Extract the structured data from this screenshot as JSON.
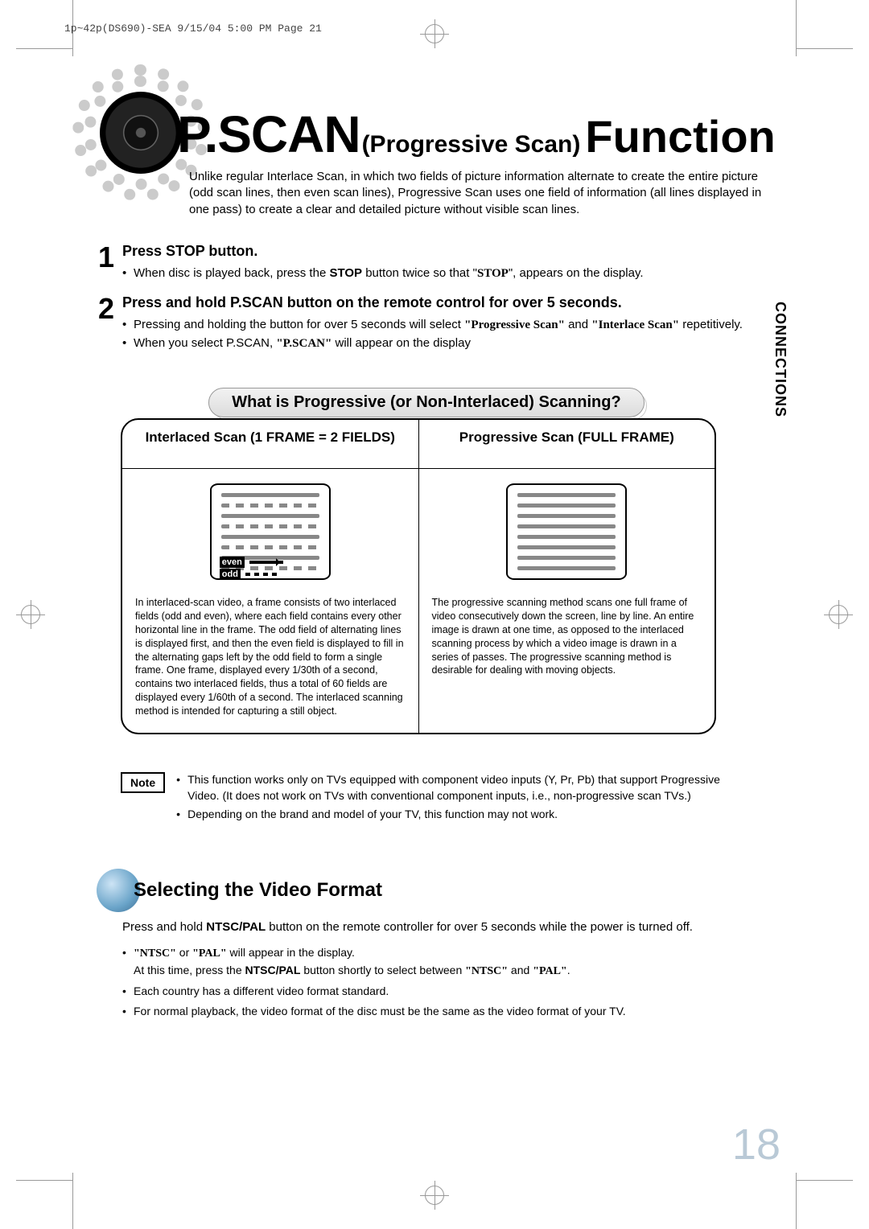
{
  "header_strip": "1p~42p(DS690)-SEA  9/15/04 5:00 PM  Page 21",
  "title": {
    "pscan": "P.SCAN",
    "sub": "(Progressive Scan)",
    "func": "Function"
  },
  "intro": "Unlike regular Interlace Scan, in which two fields of picture information alternate to create the entire picture (odd scan lines, then even scan lines), Progressive Scan uses one field of information (all lines displayed in one pass) to create a clear and detailed picture without visible scan lines.",
  "steps": [
    {
      "num": "1",
      "heading": "Press STOP button.",
      "bullets": [
        {
          "pre": "When disc is played back, press the ",
          "b1": "STOP",
          "mid": " button twice so that \"",
          "q": "STOP",
          "post": "\", appears on the display."
        }
      ]
    },
    {
      "num": "2",
      "heading": "Press and hold P.SCAN button on the remote control for over 5 seconds.",
      "bullets": [
        {
          "pre": "Pressing and holding the button for over 5 seconds will select ",
          "q": "\"Progressive Scan\"",
          "mid": " and ",
          "q2": "\"Interlace Scan\"",
          "post": " repetitively."
        },
        {
          "pre": "When you select P.SCAN, ",
          "q": "\"P.SCAN\"",
          "post": " will appear on the display"
        }
      ]
    }
  ],
  "side_tab": "CONNECTIONS",
  "info_heading": "What is Progressive (or Non-Interlaced) Scanning?",
  "compare": {
    "left": {
      "head": "Interlaced Scan (1 FRAME = 2 FIELDS)",
      "legend_even": "even",
      "legend_odd": "odd",
      "text": "In interlaced-scan video, a frame consists of two interlaced fields (odd and even), where each field contains every other horizontal line in the frame. The odd field of alternating lines is displayed first, and then the even field is displayed to fill in the alternating gaps left by the odd field to form a single frame. One frame, displayed every 1/30th of a second, contains two interlaced fields, thus a total of 60 fields are displayed every 1/60th of a second. The interlaced scanning method is intended for capturing a still object."
    },
    "right": {
      "head": "Progressive Scan (FULL FRAME)",
      "text": "The progressive scanning method scans one full frame of video consecutively down the screen, line by line. An entire image is drawn at one time, as opposed to the interlaced scanning process by which a video image is drawn in a series of passes. The progressive scanning method is desirable for dealing with moving objects."
    }
  },
  "note": {
    "label": "Note",
    "items": [
      "This function works only on TVs equipped with component video inputs (Y, Pr, Pb) that support Progressive Video. (It does not work on TVs with conventional component inputs, i.e., non-progressive scan TVs.)",
      "Depending on the brand and model of your TV, this function may not work."
    ]
  },
  "subsection": {
    "title": "Selecting the Video Format",
    "lead": {
      "pre": "Press and hold ",
      "b": "NTSC/PAL",
      "post": " button on the remote controller for over 5 seconds while the power is turned off."
    },
    "bullets": [
      {
        "q1": "\"NTSC\"",
        "mid1": " or ",
        "q2": "\"PAL\"",
        "mid2": " will appear in the display.\nAt this time, press the ",
        "b": "NTSC/PAL",
        "mid3": " button shortly to select between ",
        "q3": "\"NTSC\"",
        "mid4": " and ",
        "q4": "\"PAL\"",
        "post": "."
      },
      {
        "text": "Each country has a different video format standard."
      },
      {
        "text": "For normal playback, the video format of the disc must be the same as the video format of your TV."
      }
    ]
  },
  "page_number": "18"
}
